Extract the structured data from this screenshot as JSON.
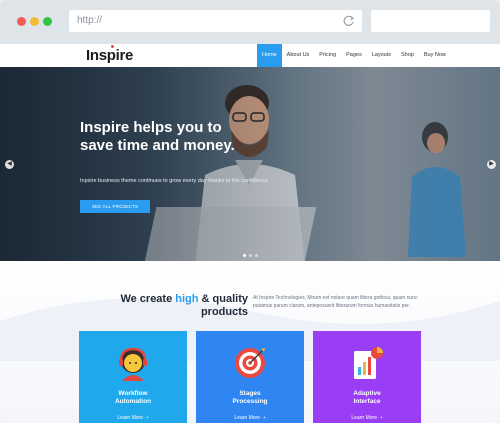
{
  "browser": {
    "url": "http://"
  },
  "nav": {
    "logo": "Inspire",
    "items": [
      {
        "label": "Home",
        "active": true
      },
      {
        "label": "About Us",
        "active": false
      },
      {
        "label": "Pricing",
        "active": false
      },
      {
        "label": "Pages",
        "active": false
      },
      {
        "label": "Layouts",
        "active": false
      },
      {
        "label": "Shop",
        "active": false
      },
      {
        "label": "Buy Now",
        "active": false
      }
    ]
  },
  "hero": {
    "title": "Inspire helps you to save time and money.",
    "subtitle": "Inpsire business theme continues to grow every day thanks to the confidence.",
    "button": "SEE ALL PROJECTS",
    "slide_count": 3,
    "active_slide": 1
  },
  "section": {
    "headline_pre": "We create ",
    "headline_highlight": "high",
    "headline_post": " & quality products",
    "description": "At Inspire Technologies, Mirum est notare quam littera gothica, quam nunc putamus parum claram, anteposuerit litterarum formas humanitatis per."
  },
  "cards": [
    {
      "title_line1": "Workflow",
      "title_line2": "Automation",
      "link": "Learn More",
      "icon": "support-agent-icon",
      "color": "#1fa8ec"
    },
    {
      "title_line1": "Stages",
      "title_line2": "Processing",
      "link": "Learn More",
      "icon": "target-icon",
      "color": "#2f86f3"
    },
    {
      "title_line1": "Adaptive",
      "title_line2": "Interface",
      "link": "Learn More",
      "icon": "chart-icon",
      "color": "#9a3ef5"
    }
  ],
  "colors": {
    "accent": "#2a9cf0",
    "heading": "#1f2a3a"
  }
}
